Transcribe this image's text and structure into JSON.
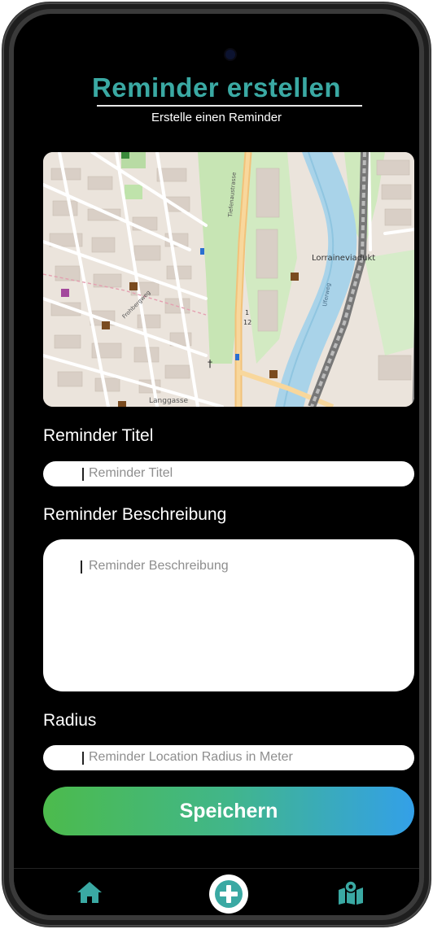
{
  "header": {
    "title": "Reminder erstellen",
    "subtitle": "Erstelle einen Reminder"
  },
  "map": {
    "street_labels": [
      "Lorraineviadukt",
      "Langgasse",
      "Tiefenaustrasse",
      "Uferweg",
      "Frohbergweg"
    ]
  },
  "form": {
    "title_label": "Reminder Titel",
    "title_placeholder": "Reminder Titel",
    "description_label": "Reminder Beschreibung",
    "description_placeholder": "Reminder Beschreibung",
    "radius_label": "Radius",
    "radius_placeholder": "Reminder Location Radius in Meter",
    "save_label": "Speichern"
  },
  "nav": {
    "items": [
      {
        "icon": "home-icon"
      },
      {
        "icon": "plus-icon"
      },
      {
        "icon": "map-icon"
      }
    ]
  },
  "colors": {
    "title": "#3aa9a3",
    "button_gradient_start": "#4cbb4c",
    "button_gradient_end": "#33a0e8",
    "nav_icon": "#3aa9a3"
  }
}
